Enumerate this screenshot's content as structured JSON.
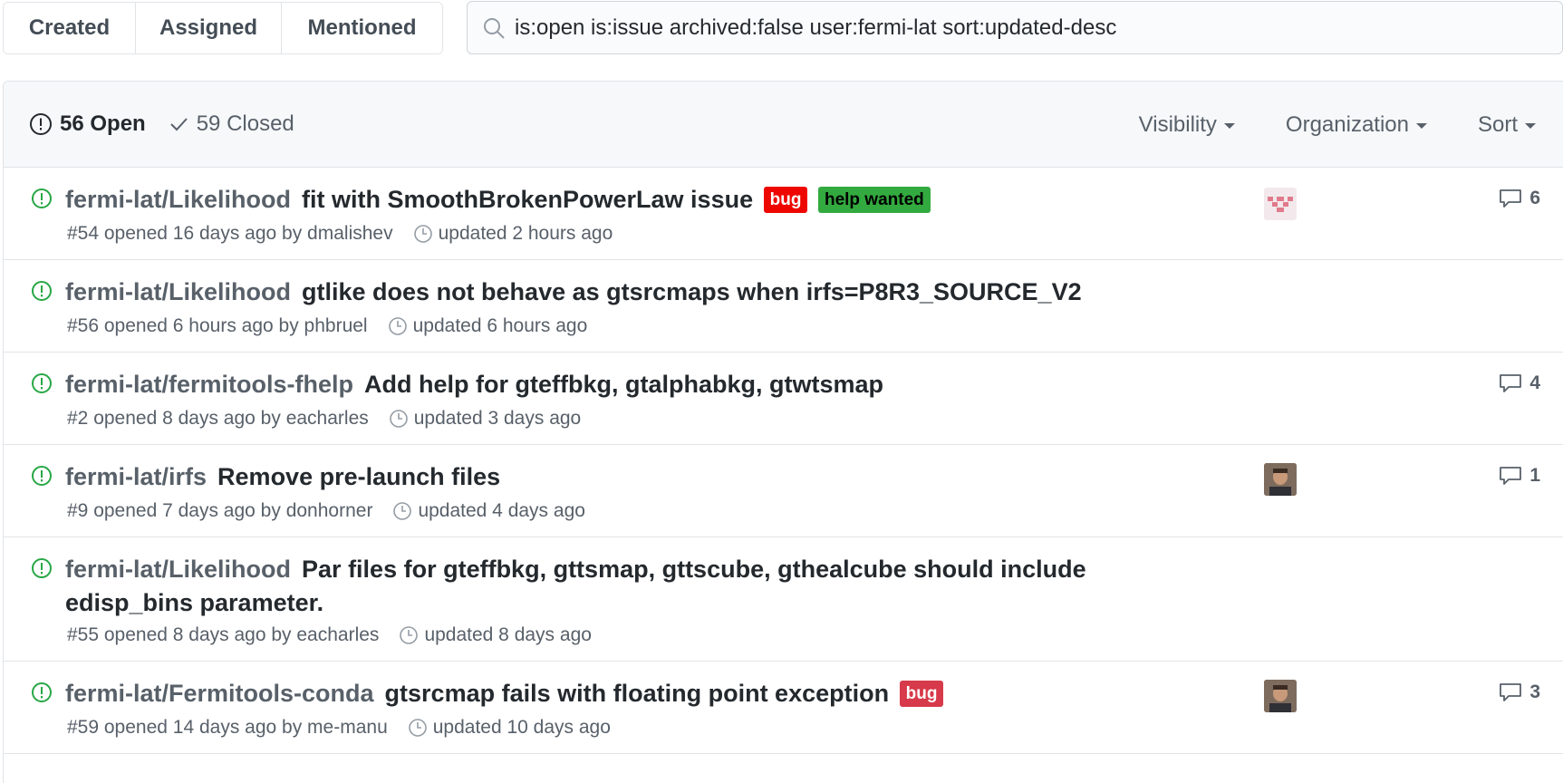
{
  "tabs": [
    {
      "label": "Created"
    },
    {
      "label": "Assigned"
    },
    {
      "label": "Mentioned"
    }
  ],
  "search": {
    "value": "is:open is:issue archived:false user:fermi-lat sort:updated-desc"
  },
  "states": {
    "open_label": "56 Open",
    "closed_label": "59 Closed"
  },
  "filters": {
    "visibility": "Visibility",
    "organization": "Organization",
    "sort": "Sort"
  },
  "issues": [
    {
      "repo": "fermi-lat/Likelihood",
      "title": "fit with SmoothBrokenPowerLaw issue",
      "labels": [
        "bug",
        "help wanted"
      ],
      "meta": "#54 opened 16 days ago by dmalishev",
      "updated": "updated 2 hours ago",
      "comments": "6",
      "avatar": "identicon"
    },
    {
      "repo": "fermi-lat/Likelihood",
      "title": "gtlike does not behave as gtsrcmaps when irfs=P8R3_SOURCE_V2",
      "labels": [],
      "meta": "#56 opened 6 hours ago by phbruel",
      "updated": "updated 6 hours ago",
      "comments": "",
      "avatar": ""
    },
    {
      "repo": "fermi-lat/fermitools-fhelp",
      "title": "Add help for gteffbkg, gtalphabkg, gtwtsmap",
      "labels": [],
      "meta": "#2 opened 8 days ago by eacharles",
      "updated": "updated 3 days ago",
      "comments": "4",
      "avatar": ""
    },
    {
      "repo": "fermi-lat/irfs",
      "title": "Remove pre-launch files",
      "labels": [],
      "meta": "#9 opened 7 days ago by donhorner",
      "updated": "updated 4 days ago",
      "comments": "1",
      "avatar": "photo"
    },
    {
      "repo": "fermi-lat/Likelihood",
      "title": "Par files for gteffbkg, gttsmap, gttscube, gthealcube should include edisp_bins parameter.",
      "labels": [],
      "meta": "#55 opened 8 days ago by eacharles",
      "updated": "updated 8 days ago",
      "comments": "",
      "avatar": ""
    },
    {
      "repo": "fermi-lat/Fermitools-conda",
      "title": "gtsrcmap fails with floating point exception",
      "labels": [
        "bug"
      ],
      "meta": "#59 opened 14 days ago by me-manu",
      "updated": "updated 10 days ago",
      "comments": "3",
      "avatar": "photo"
    }
  ],
  "colors": {
    "open_green": "#28a745",
    "bug_red": "#ee0701",
    "help_green": "#33aa3f"
  }
}
